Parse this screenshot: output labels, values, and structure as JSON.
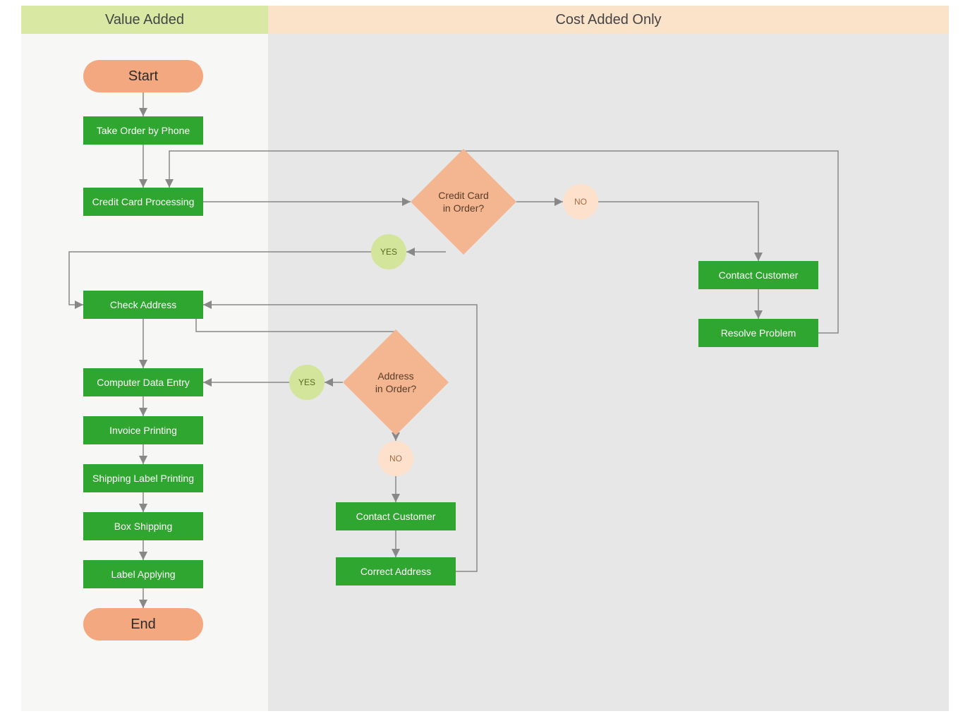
{
  "headers": {
    "left": "Value Added",
    "right": "Cost Added Only"
  },
  "terminals": {
    "start": "Start",
    "end": "End"
  },
  "process": {
    "take_order": "Take Order by Phone",
    "cc_processing": "Credit Card Processing",
    "check_address": "Check Address",
    "data_entry": "Computer Data Entry",
    "invoice": "Invoice Printing",
    "ship_label": "Shipping Label Printing",
    "box_shipping": "Box Shipping",
    "label_applying": "Label Applying",
    "contact_customer_top": "Contact Customer",
    "resolve_problem": "Resolve Problem",
    "contact_customer_bottom": "Contact Customer",
    "correct_address": "Correct Address"
  },
  "decisions": {
    "credit_card": "Credit Card\nin Order?",
    "address": "Address\nin Order?"
  },
  "labels": {
    "yes": "YES",
    "no": "NO"
  }
}
